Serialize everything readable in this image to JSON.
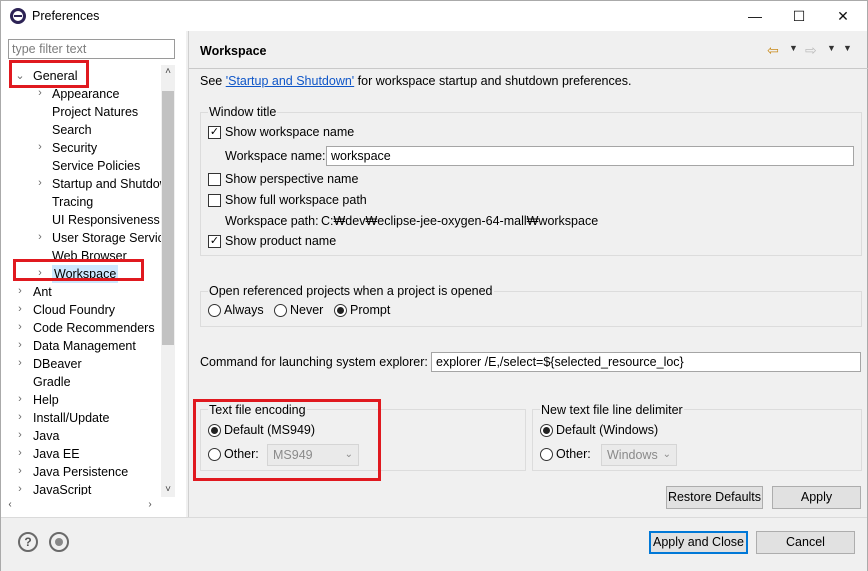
{
  "window": {
    "title": "Preferences",
    "minimize": "—",
    "maximize": "☐",
    "close": "✕"
  },
  "filter": {
    "placeholder": "type filter text"
  },
  "tree": {
    "items": [
      {
        "label": "General",
        "chevron": "⌄"
      },
      {
        "label": "Appearance",
        "chevron": "›"
      },
      {
        "label": "Project Natures",
        "chevron": ""
      },
      {
        "label": "Search",
        "chevron": ""
      },
      {
        "label": "Security",
        "chevron": "›"
      },
      {
        "label": "Service Policies",
        "chevron": ""
      },
      {
        "label": "Startup and Shutdown",
        "chevron": "›"
      },
      {
        "label": "Tracing",
        "chevron": ""
      },
      {
        "label": "UI Responsiveness Monitoring",
        "chevron": ""
      },
      {
        "label": "User Storage Service",
        "chevron": "›"
      },
      {
        "label": "Web Browser",
        "chevron": ""
      },
      {
        "label": "Workspace",
        "chevron": "›"
      },
      {
        "label": "Ant",
        "chevron": "›"
      },
      {
        "label": "Cloud Foundry",
        "chevron": "›"
      },
      {
        "label": "Code Recommenders",
        "chevron": "›"
      },
      {
        "label": "Data Management",
        "chevron": "›"
      },
      {
        "label": "DBeaver",
        "chevron": "›"
      },
      {
        "label": "Gradle",
        "chevron": ""
      },
      {
        "label": "Help",
        "chevron": "›"
      },
      {
        "label": "Install/Update",
        "chevron": "›"
      },
      {
        "label": "Java",
        "chevron": "›"
      },
      {
        "label": "Java EE",
        "chevron": "›"
      },
      {
        "label": "Java Persistence",
        "chevron": "›"
      },
      {
        "label": "JavaScript",
        "chevron": "›"
      }
    ]
  },
  "page": {
    "title": "Workspace",
    "see_prefix": "See ",
    "see_link": "'Startup and Shutdown'",
    "see_suffix": " for workspace startup and shutdown preferences.",
    "window_title_group": "Window title",
    "show_workspace_name": "Show workspace name",
    "workspace_name_label": "Workspace name:",
    "workspace_name_value": "workspace",
    "show_perspective_name": "Show perspective name",
    "show_full_path": "Show full workspace path",
    "workspace_path_label": "Workspace path:",
    "workspace_path_value": "C:₩dev₩eclipse-jee-oxygen-64-mall₩workspace",
    "show_product_name": "Show product name",
    "open_ref_label": "Open referenced projects when a project is opened",
    "always": "Always",
    "never": "Never",
    "prompt": "Prompt",
    "cmd_label": "Command for launching system explorer:",
    "cmd_value": "explorer /E,/select=${selected_resource_loc}",
    "encoding_group": "Text file encoding",
    "enc_default": "Default (MS949)",
    "enc_other": "Other:",
    "enc_combo": "MS949",
    "delimiter_group": "New text file line delimiter",
    "delim_default": "Default (Windows)",
    "delim_other": "Other:",
    "delim_combo": "Windows",
    "restore_defaults": "Restore Defaults",
    "apply": "Apply"
  },
  "footer": {
    "help_icon_glyph": "?",
    "apply_close": "Apply and Close",
    "cancel": "Cancel"
  },
  "colors": {
    "highlight": "#e0191f",
    "selection": "#cce8ff",
    "link": "#0f56c8"
  }
}
